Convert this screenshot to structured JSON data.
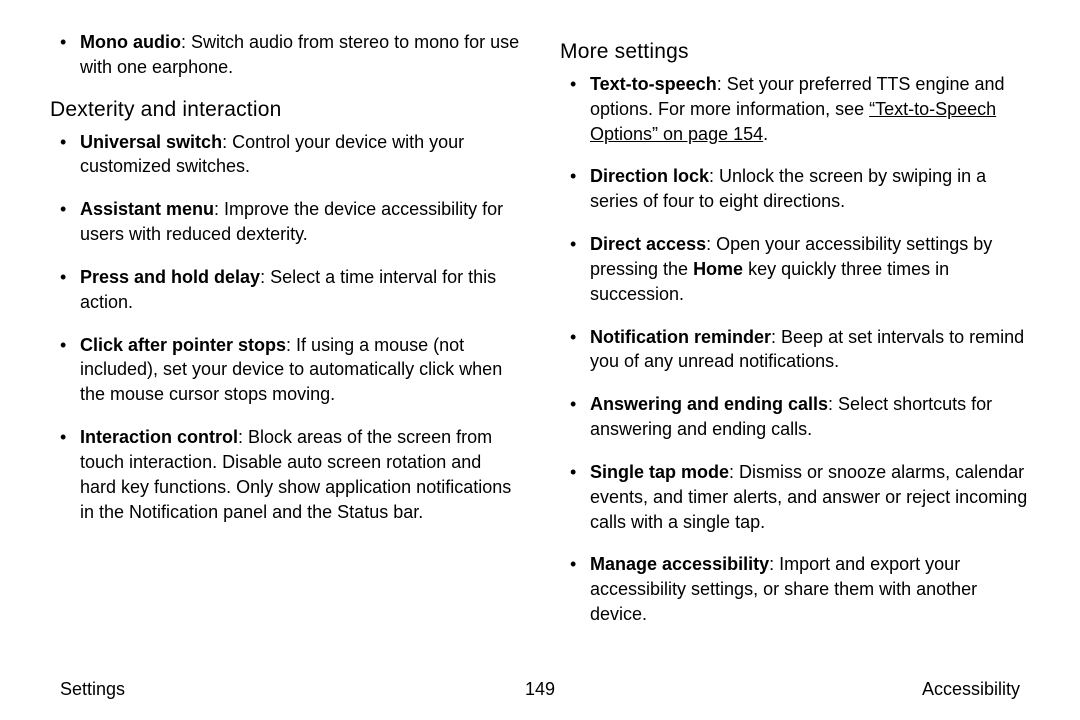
{
  "left": {
    "items_above": [
      {
        "term": "Mono audio",
        "desc": ": Switch audio from stereo to mono for use with one earphone."
      }
    ],
    "section": "Dexterity and interaction",
    "items": [
      {
        "term": "Universal switch",
        "desc": ": Control your device with your customized switches."
      },
      {
        "term": "Assistant menu",
        "desc": ": Improve the device accessibility for users with reduced dexterity."
      },
      {
        "term": "Press and hold delay",
        "desc": ": Select a time interval for this action."
      },
      {
        "term": "Click after pointer stops",
        "desc": ": If using a mouse (not included), set your device to automatically click when the mouse cursor stops moving."
      },
      {
        "term": "Interaction control",
        "desc": ": Block areas of the screen from touch interaction. Disable auto screen rotation and hard key functions. Only show application notifications in the Notification panel and the Status bar."
      }
    ]
  },
  "right": {
    "section": "More settings",
    "tts": {
      "term": "Text-to-speech",
      "lead": ": Set your preferred TTS engine and options. For more information, see ",
      "link": "“Text-to-Speech Options” on page 154",
      "tail": "."
    },
    "items": [
      {
        "term": "Direction lock",
        "desc": ": Unlock the screen by swiping in a series of four to eight directions."
      },
      {
        "pre": "Direct access",
        "lead": ": Open your accessibility settings by pressing the ",
        "mid_bold": "Home",
        "tail": " key quickly three times in succession."
      },
      {
        "term": "Notification reminder",
        "desc": ": Beep at set intervals to remind you of any unread notifications."
      },
      {
        "term": "Answering and ending calls",
        "desc": ": Select shortcuts for answering and ending calls."
      },
      {
        "term": "Single tap mode",
        "desc": ": Dismiss or snooze alarms, calendar events, and timer alerts, and answer or reject incoming calls with a single tap."
      },
      {
        "term": "Manage accessibility",
        "desc": ": Import and export your accessibility settings, or share them with another device."
      }
    ]
  },
  "footer": {
    "left": "Settings",
    "center": "149",
    "right": "Accessibility"
  }
}
